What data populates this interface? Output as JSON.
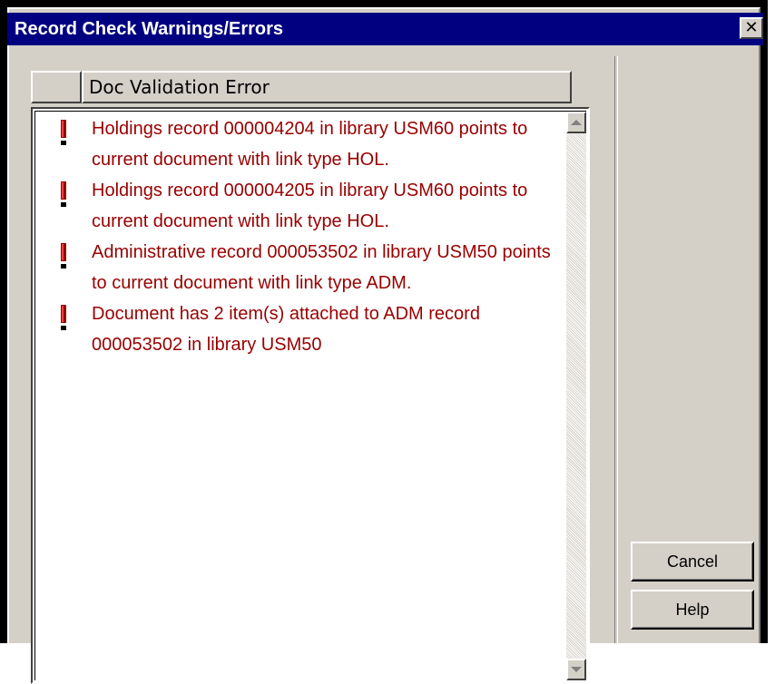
{
  "window": {
    "title": "Record Check Warnings/Errors",
    "close_icon": "close-icon"
  },
  "list": {
    "column_header": "Doc Validation Error",
    "row_icon": "exclamation-icon",
    "text_color": "#990000",
    "rows": [
      {
        "text": "Holdings record 000004204 in library USM60 points to current document with link type HOL."
      },
      {
        "text": "Holdings record 000004205 in library USM60 points to current document with link type HOL."
      },
      {
        "text": "Administrative record 000053502 in library USM50 points to current document with link type ADM."
      },
      {
        "text": "Document has 2 item(s) attached to ADM record 000053502 in library USM50"
      }
    ]
  },
  "buttons": {
    "cancel_label": "Cancel",
    "help_label": "Help"
  },
  "colors": {
    "titlebar": "#000080",
    "face": "#d4d0c8"
  }
}
